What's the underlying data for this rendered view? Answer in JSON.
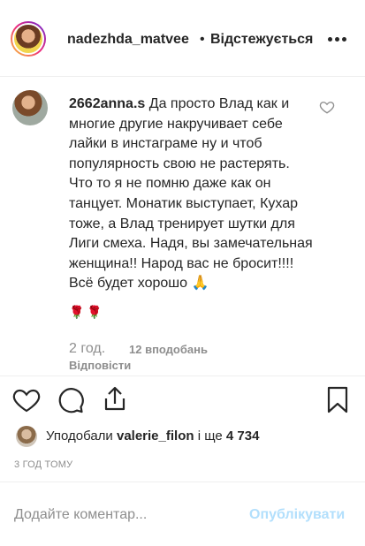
{
  "header": {
    "username": "nadezhda_matvee",
    "separator": "•",
    "follow_status": "Відстежується"
  },
  "comment": {
    "username": "2662anna.s",
    "text": "Да просто Влад как и многие другие накручивает себе лайки в инстаграме ну и чтоб популярность свою не растерять. Что то я не помню даже как он танцует. Монатик выступает, Кухар тоже, а Влад тренирует шутки для Лиги смеха. Надя, вы замечательная женщина!! Народ вас не бросит!!!! Всё будет хорошо 🙏",
    "emoji_tail": "🌹🌹",
    "time": "2 год.",
    "likes": "12 вподобань",
    "reply": "Відповісти"
  },
  "likes": {
    "prefix": "Уподобали",
    "user": "valerie_filon",
    "and": "і ще",
    "count": "4 734"
  },
  "timestamp": "3 ГОД ТОМУ",
  "add_comment": {
    "placeholder": "Додайте коментар...",
    "post_label": "Опублікувати"
  },
  "icons": [
    "more-icon",
    "heart-icon",
    "comment-icon",
    "share-icon",
    "bookmark-icon",
    "small-heart-icon"
  ],
  "colors": {
    "muted": "#8e8e8e",
    "text": "#262626",
    "post_disabled": "#b2dffc",
    "divider": "#efefef"
  }
}
